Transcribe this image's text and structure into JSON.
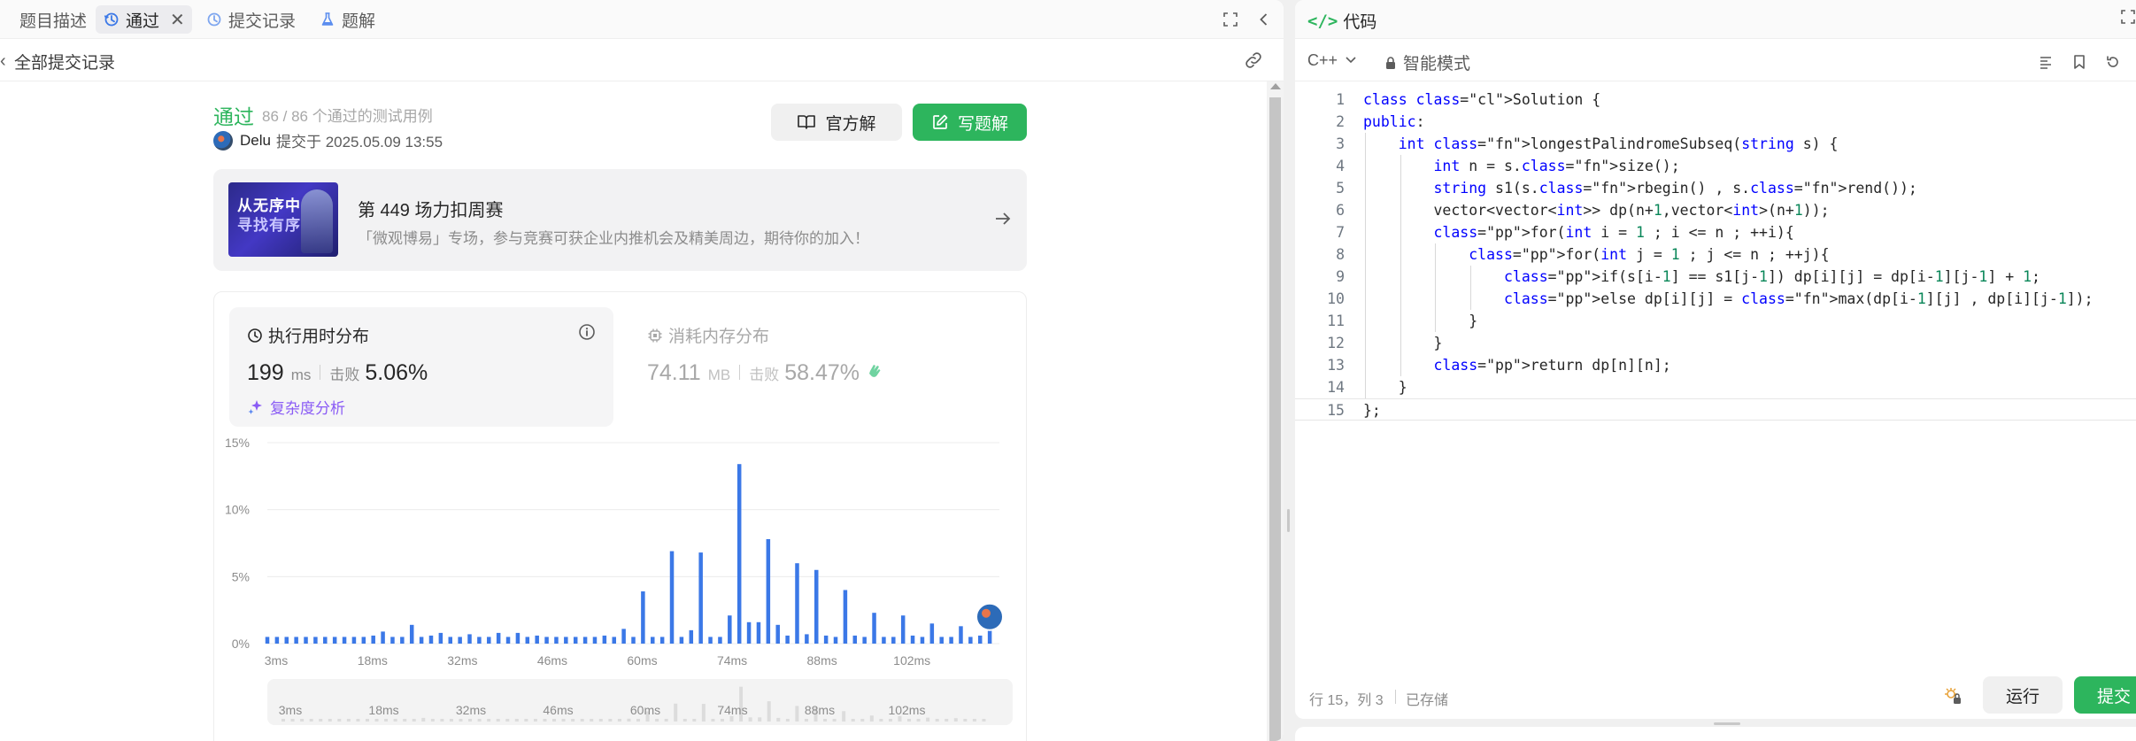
{
  "left_tabs": [
    {
      "label": "题目描述",
      "icon": "description-icon"
    },
    {
      "label": "通过",
      "icon": "history-icon",
      "active": true
    },
    {
      "label": "提交记录",
      "icon": "history-icon"
    },
    {
      "label": "题解",
      "icon": "flask-icon"
    }
  ],
  "sub_header": {
    "back_label": "全部提交记录"
  },
  "submission": {
    "status": "通过",
    "test_summary": "86 / 86 个通过的测试用例",
    "author": "Delu",
    "submitted_at": "提交于 2025.05.09 13:55",
    "official_solution_label": "官方解",
    "write_solution_label": "写题解"
  },
  "banner": {
    "image_text_1": "从无序中",
    "image_text_2": "寻找有序",
    "title": "第 449 场力扣周赛",
    "subtitle": "「微观博易」专场，参与竞赛可获企业内推机会及精美周边，期待你的加入！"
  },
  "runtime": {
    "title": "执行用时分布",
    "value": "199",
    "unit": "ms",
    "beat_label": "击败",
    "beat_value": "5.06%",
    "analysis_label": "复杂度分析"
  },
  "memory": {
    "title": "消耗内存分布",
    "value": "74.11",
    "unit": "MB",
    "beat_label": "击败",
    "beat_value": "58.47%"
  },
  "chart_data": {
    "type": "bar",
    "title": "",
    "xlabel": "",
    "ylabel": "",
    "ylim": [
      0,
      15
    ],
    "yticks": [
      "0%",
      "5%",
      "10%",
      "15%"
    ],
    "xticks": [
      "3ms",
      "18ms",
      "32ms",
      "46ms",
      "60ms",
      "74ms",
      "88ms",
      "102ms"
    ],
    "xtick_values": [
      3,
      18,
      32,
      46,
      60,
      74,
      88,
      102
    ],
    "x": [
      3,
      4.5,
      6,
      7.5,
      9,
      10.5,
      12,
      13.5,
      15,
      16.5,
      18,
      19.5,
      21,
      22.5,
      24,
      25.5,
      27,
      28.5,
      30,
      31.5,
      33,
      34.5,
      36,
      37.5,
      39,
      40.5,
      42,
      43.5,
      45,
      46.5,
      48,
      49.5,
      51,
      52.5,
      54,
      55.5,
      57,
      58.5,
      60,
      61.5,
      63,
      64.5,
      66,
      67.5,
      69,
      70.5,
      72,
      73.5,
      75,
      76.5,
      78,
      79.5,
      81,
      82.5,
      84,
      85.5,
      87,
      88.5,
      90,
      91.5,
      93,
      94.5,
      96,
      97.5,
      99,
      100.5,
      102,
      103.5,
      105,
      106.5,
      108,
      109.5,
      111,
      112.5,
      114,
      115.5
    ],
    "values": [
      0.5,
      0.5,
      0.5,
      0.5,
      0.5,
      0.5,
      0.5,
      0.5,
      0.5,
      0.5,
      0.5,
      0.6,
      0.9,
      0.5,
      0.5,
      1.4,
      0.5,
      0.6,
      0.8,
      0.5,
      0.5,
      0.7,
      0.5,
      0.5,
      0.8,
      0.5,
      0.8,
      0.5,
      0.6,
      0.5,
      0.5,
      0.5,
      0.5,
      0.5,
      0.5,
      0.6,
      0.5,
      1.1,
      0.5,
      3.9,
      0.5,
      0.5,
      6.9,
      0.5,
      1.0,
      6.8,
      0.5,
      0.5,
      2.1,
      13.4,
      1.6,
      1.6,
      7.8,
      1.4,
      0.6,
      6.0,
      0.7,
      5.5,
      0.6,
      0.5,
      4.0,
      0.6,
      0.5,
      2.3,
      0.5,
      0.5,
      2.1,
      0.6,
      0.5,
      1.5,
      0.5,
      0.5,
      1.3,
      0.5,
      0.6,
      1.0,
      0.5,
      0.5,
      1.3,
      0.5,
      0.5,
      0.8
    ],
    "bar_color": "#3b78e7",
    "mini_xticks": [
      "3ms",
      "18ms",
      "32ms",
      "46ms",
      "60ms",
      "74ms",
      "88ms",
      "102ms"
    ]
  },
  "code_panel": {
    "title": "代码",
    "language": "C++",
    "mode_label": "智能模式",
    "lines": [
      "class Solution {",
      "public:",
      "    int longestPalindromeSubseq(string s) {",
      "        int n = s.size();",
      "        string s1(s.rbegin() , s.rend());",
      "        vector<vector<int>> dp(n+1,vector<int>(n+1));",
      "        for(int i = 1 ; i <= n ; ++i){",
      "            for(int j = 1 ; j <= n ; ++j){",
      "                if(s[i-1] == s1[j-1]) dp[i][j] = dp[i-1][j-1] + 1;",
      "                else dp[i][j] = max(dp[i-1][j] , dp[i][j-1]);",
      "            }",
      "        }",
      "        return dp[n][n];",
      "    }",
      "};"
    ],
    "cursor_position": "行 15，列 3",
    "saved_label": "已存储",
    "run_label": "运行",
    "submit_label": "提交"
  },
  "colors": {
    "accent_green": "#2db55d",
    "bar_blue": "#3b78e7",
    "purple": "#8a5cf5"
  }
}
